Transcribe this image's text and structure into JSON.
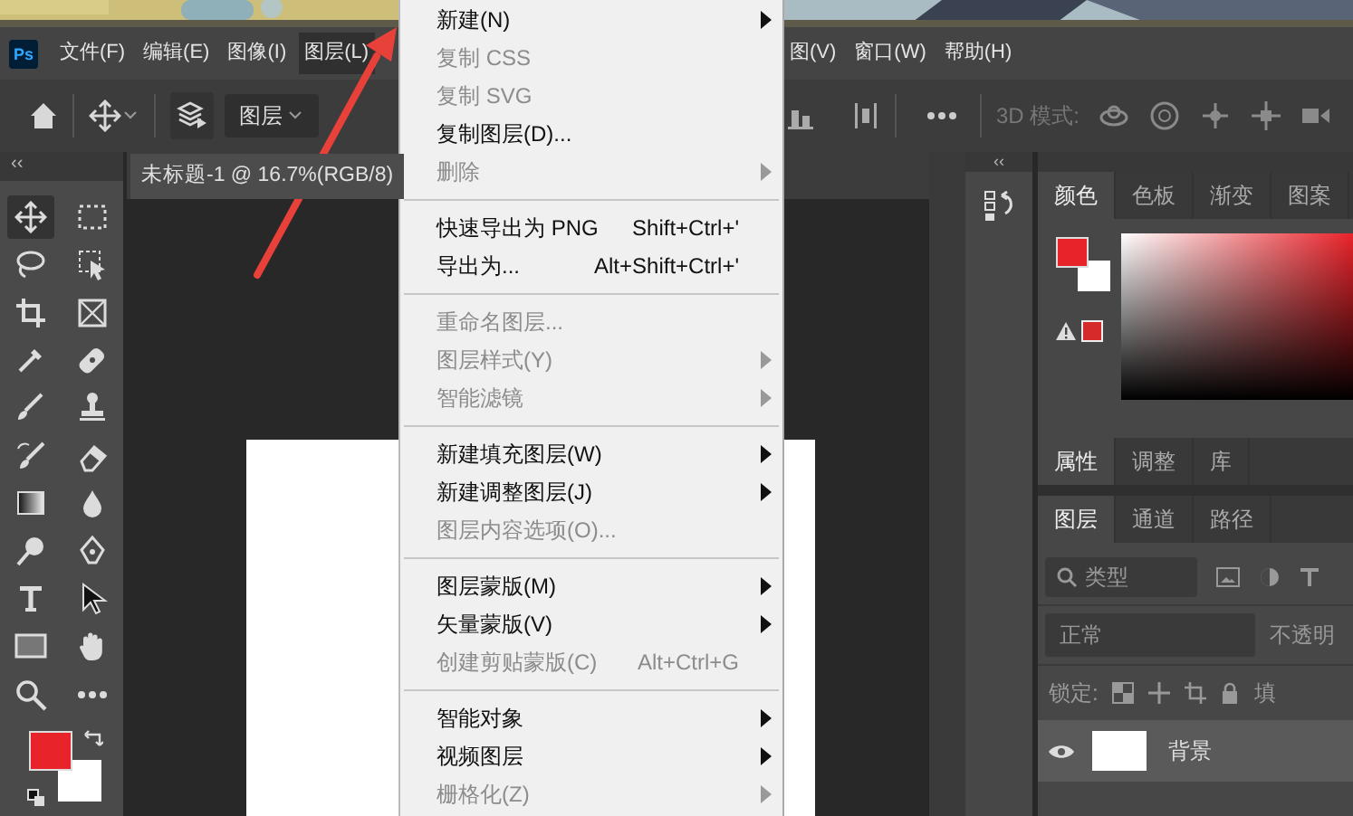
{
  "menubar": {
    "logo": "Ps",
    "left": [
      {
        "label": "文件(F)",
        "selected": false
      },
      {
        "label": "编辑(E)",
        "selected": false
      },
      {
        "label": "图像(I)",
        "selected": false
      },
      {
        "label": "图层(L)",
        "selected": true
      }
    ],
    "right": [
      {
        "label": "图(V)",
        "selected": false
      },
      {
        "label": "窗口(W)",
        "selected": false
      },
      {
        "label": "帮助(H)",
        "selected": false
      }
    ]
  },
  "options_bar": {
    "target_dropdown": "图层",
    "mode_label": "3D 模式:"
  },
  "left_collapse": "‹‹",
  "document_tab": {
    "title": "未标题-1 @ 16.7%(RGB/8)"
  },
  "tools": [
    {
      "selected": true
    },
    {
      "selected": false
    },
    {
      "selected": false
    },
    {
      "selected": false
    },
    {
      "selected": false
    },
    {
      "selected": false
    },
    {
      "selected": false
    },
    {
      "selected": false
    },
    {
      "selected": false
    },
    {
      "selected": false
    },
    {
      "selected": false
    },
    {
      "selected": false
    },
    {
      "selected": false
    },
    {
      "selected": false
    },
    {
      "selected": false
    },
    {
      "selected": false
    },
    {
      "selected": false
    },
    {
      "selected": false
    },
    {
      "selected": false
    },
    {
      "selected": false
    },
    {
      "selected": false
    },
    {
      "selected": false
    }
  ],
  "right_collapse": "‹‹",
  "color_panel": {
    "tabs": [
      {
        "label": "颜色",
        "selected": true
      },
      {
        "label": "色板",
        "selected": false
      },
      {
        "label": "渐变",
        "selected": false
      },
      {
        "label": "图案",
        "selected": false
      }
    ]
  },
  "properties_panel": {
    "tabs": [
      {
        "label": "属性",
        "selected": true
      },
      {
        "label": "调整",
        "selected": false
      },
      {
        "label": "库",
        "selected": false
      }
    ]
  },
  "layers_panel": {
    "tabs": [
      {
        "label": "图层",
        "selected": true
      },
      {
        "label": "通道",
        "selected": false
      },
      {
        "label": "路径",
        "selected": false
      }
    ],
    "filter_kind": "类型",
    "blend_mode": "正常",
    "opacity_label": "不透明",
    "lock_label": "锁定:",
    "fill_label": "填",
    "layers": [
      {
        "name": "背景",
        "visible": true
      }
    ]
  },
  "layer_menu": {
    "items": [
      {
        "kind": "item",
        "label": "新建(N)",
        "disabled": false,
        "submenu": true
      },
      {
        "kind": "item",
        "label": "复制 CSS",
        "disabled": true,
        "submenu": false
      },
      {
        "kind": "item",
        "label": "复制 SVG",
        "disabled": true,
        "submenu": false
      },
      {
        "kind": "item",
        "label": "复制图层(D)...",
        "disabled": false,
        "submenu": false
      },
      {
        "kind": "item",
        "label": "删除",
        "disabled": true,
        "submenu": true
      },
      {
        "kind": "separator"
      },
      {
        "kind": "item",
        "label": "快速导出为 PNG",
        "shortcut": "Shift+Ctrl+'",
        "disabled": false,
        "submenu": false
      },
      {
        "kind": "item",
        "label": "导出为...",
        "shortcut": "Alt+Shift+Ctrl+'",
        "disabled": false,
        "submenu": false
      },
      {
        "kind": "separator"
      },
      {
        "kind": "item",
        "label": "重命名图层...",
        "disabled": true,
        "submenu": false
      },
      {
        "kind": "item",
        "label": "图层样式(Y)",
        "disabled": true,
        "submenu": true
      },
      {
        "kind": "item",
        "label": "智能滤镜",
        "disabled": true,
        "submenu": true
      },
      {
        "kind": "separator"
      },
      {
        "kind": "item",
        "label": "新建填充图层(W)",
        "disabled": false,
        "submenu": true
      },
      {
        "kind": "item",
        "label": "新建调整图层(J)",
        "disabled": false,
        "submenu": true
      },
      {
        "kind": "item",
        "label": "图层内容选项(O)...",
        "disabled": true,
        "submenu": false
      },
      {
        "kind": "separator"
      },
      {
        "kind": "item",
        "label": "图层蒙版(M)",
        "disabled": false,
        "submenu": true
      },
      {
        "kind": "item",
        "label": "矢量蒙版(V)",
        "disabled": false,
        "submenu": true
      },
      {
        "kind": "item",
        "label": "创建剪贴蒙版(C)",
        "shortcut": "Alt+Ctrl+G",
        "disabled": true,
        "submenu": false
      },
      {
        "kind": "separator"
      },
      {
        "kind": "item",
        "label": "智能对象",
        "disabled": false,
        "submenu": true
      },
      {
        "kind": "item",
        "label": "视频图层",
        "disabled": false,
        "submenu": true
      },
      {
        "kind": "item",
        "label": "栅格化(Z)",
        "disabled": true,
        "submenu": true
      }
    ]
  }
}
